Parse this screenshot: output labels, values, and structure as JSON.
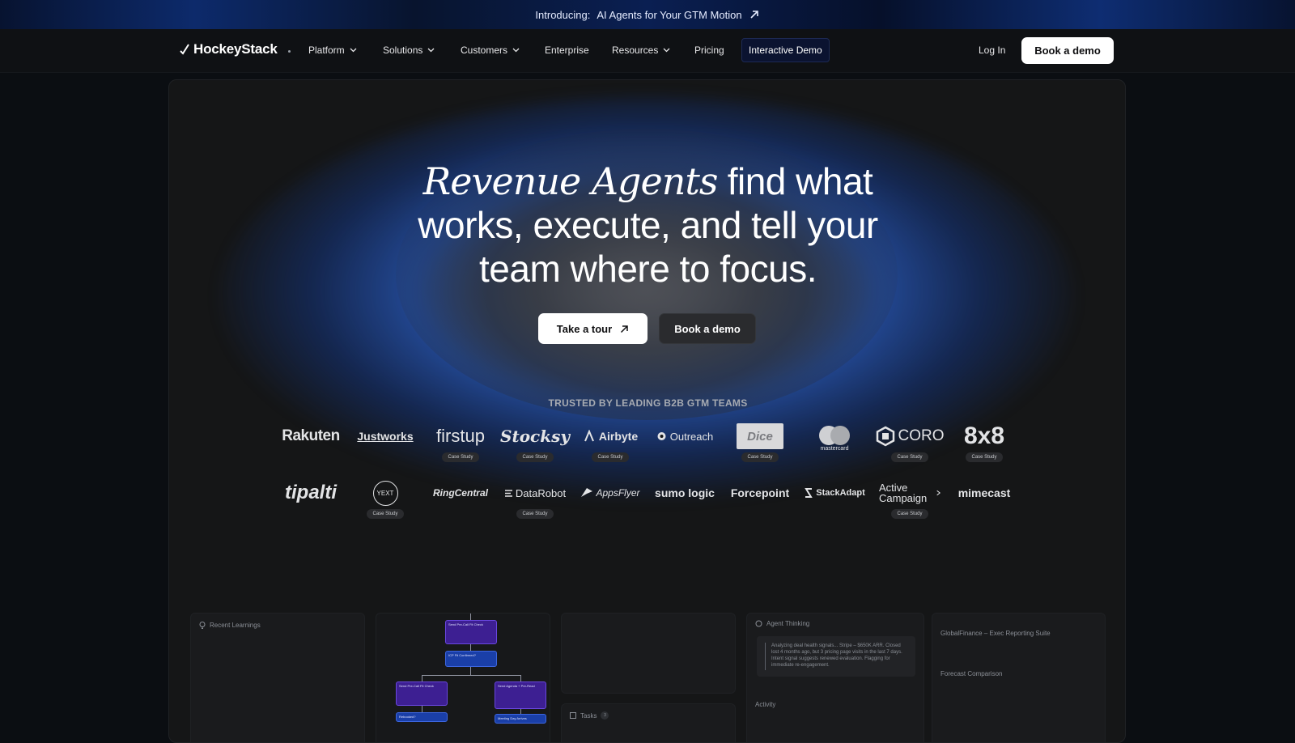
{
  "announcement": {
    "prefix": "Introducing:",
    "text": "AI Agents for Your GTM Motion"
  },
  "nav": {
    "brand": "HockeyStack",
    "items": [
      {
        "label": "Platform"
      },
      {
        "label": "Solutions"
      },
      {
        "label": "Customers"
      },
      {
        "label": "Enterprise"
      },
      {
        "label": "Resources"
      },
      {
        "label": "Pricing"
      }
    ],
    "interactive_demo": "Interactive Demo",
    "login": "Log In",
    "book_demo": "Book a demo"
  },
  "hero": {
    "headline_italic": "Revenue Agents",
    "headline_rest_1": "find what",
    "headline_line_2": "works, execute, and tell your",
    "headline_line_3": "team where to focus.",
    "cta_tour": "Take a tour",
    "cta_book": "Book a demo"
  },
  "trusted": {
    "heading": "TRUSTED BY LEADING B2B GTM TEAMS",
    "case_label": "Case Study",
    "row1": [
      "Rakuten",
      "Justworks",
      "firstup",
      "Stocksy",
      "Airbyte",
      "Outreach",
      "Dice",
      "mastercard",
      "CORO",
      "8x8"
    ],
    "row2": [
      "tipalti",
      "YEXT",
      "RingCentral",
      "DataRobot",
      "AppsFlyer",
      "sumo logic",
      "Forcepoint",
      "StackAdapt",
      "Active Campaign",
      "mimecast"
    ]
  },
  "preview": {
    "recent_learnings": "Recent Learnings",
    "agent_thinking": "Agent Thinking",
    "thinking_text": "Analyzing deal health signals... Stripe – $650K ARR. Closed lost 4 months ago, but 3 pricing page visits in the last 7 days. Intent signal suggests renewed evaluation. Flagging for immediate re-engagement.",
    "activity": "Activity",
    "tasks": "Tasks",
    "tasks_count": "3",
    "global_finance": "GlobalFinance – Exec Reporting Suite",
    "forecast": "Forecast Comparison",
    "flow": {
      "node1": "Send Pre-Call Fit Check",
      "node2": "ICP Fit Confirmed?",
      "node3": "Send Pre-Call Fit Check",
      "node4": "Send Agenda + Pre-Read",
      "node5": "Rebooked?",
      "node6": "Meeting Day Arrives"
    }
  }
}
